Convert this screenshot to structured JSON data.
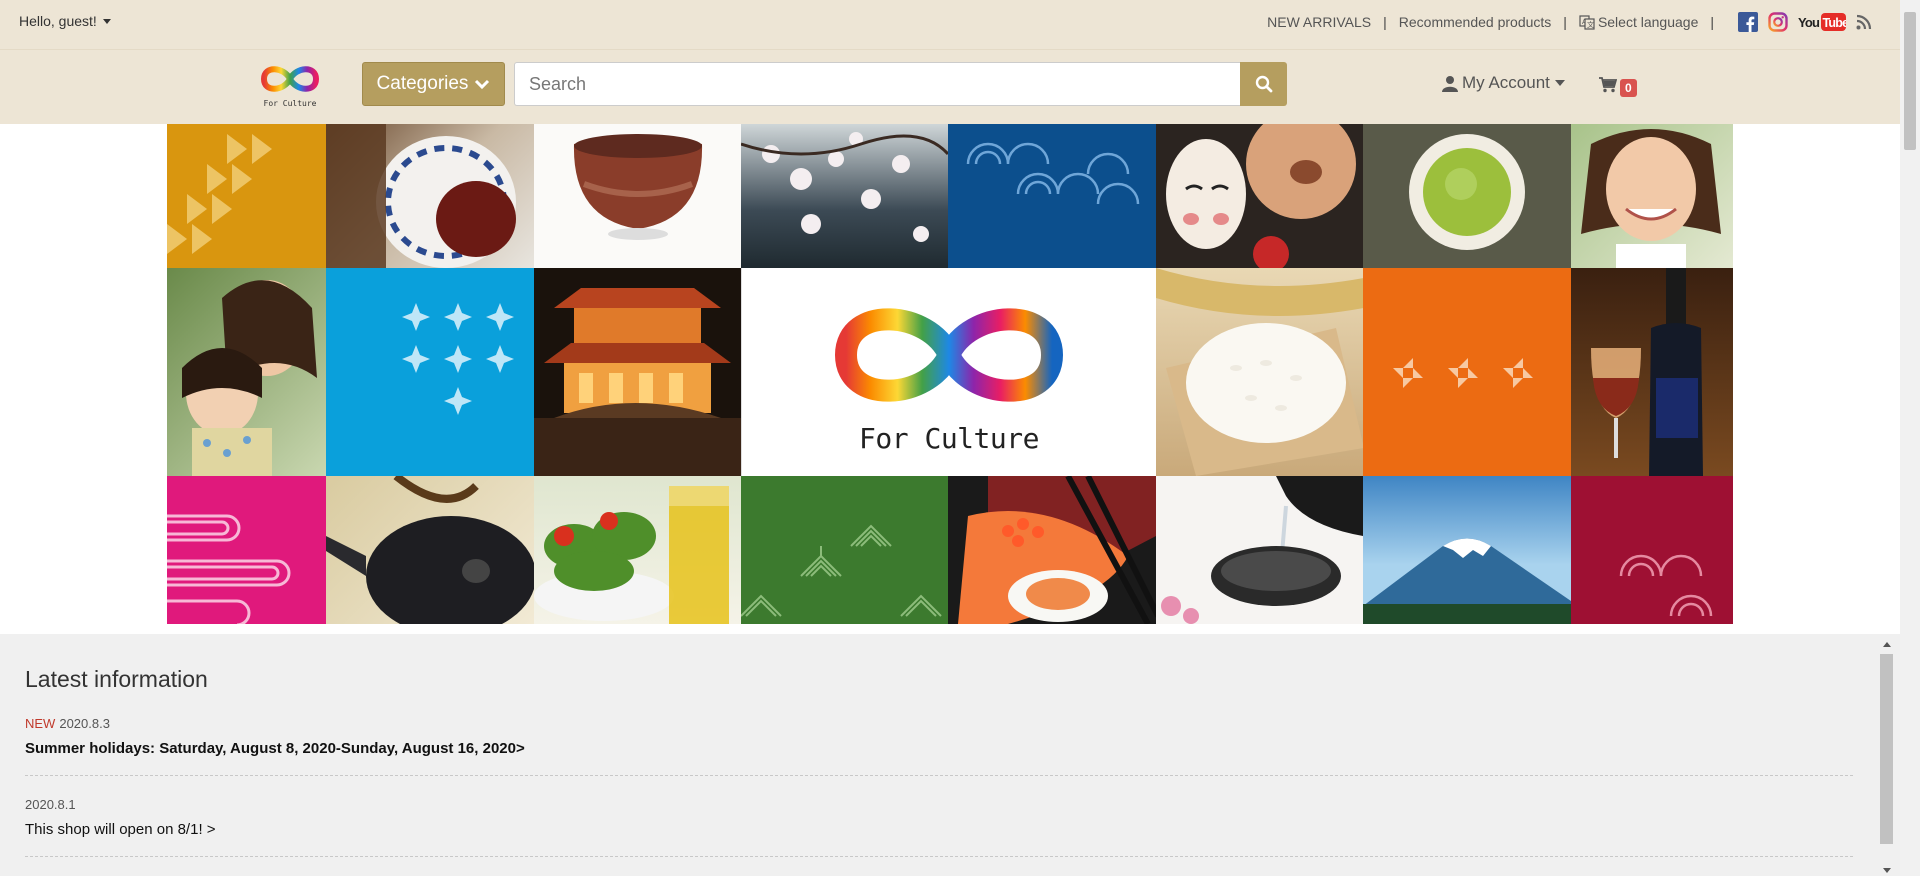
{
  "topbar": {
    "greeting": "Hello, guest!",
    "links": [
      {
        "label": "NEW ARRIVALS"
      },
      {
        "label": "Recommended products"
      },
      {
        "label": "Select language",
        "icon": "translate-icon"
      }
    ],
    "social": [
      "facebook-icon",
      "instagram-icon",
      "youtube-icon",
      "rss-icon"
    ],
    "youtube_label": "YouTube"
  },
  "header": {
    "logo_text": "For Culture",
    "categories_label": "Categories",
    "search_placeholder": "Search",
    "account_label": "My Account",
    "cart_count": "0"
  },
  "banner": {
    "center_title": "For Culture"
  },
  "info": {
    "heading": "Latest information",
    "items": [
      {
        "badge": "NEW",
        "date": "2020.8.3",
        "title": "Summer holidays: Saturday, August 8, 2020-Sunday, August 16, 2020>"
      },
      {
        "badge": "",
        "date": "2020.8.1",
        "title": "This shop will open on 8/1! >"
      }
    ]
  },
  "colors": {
    "header_bg": "#ede5d5",
    "accent": "#b59e5f",
    "cart_badge": "#d9534f",
    "new_badge": "#c0392b"
  }
}
